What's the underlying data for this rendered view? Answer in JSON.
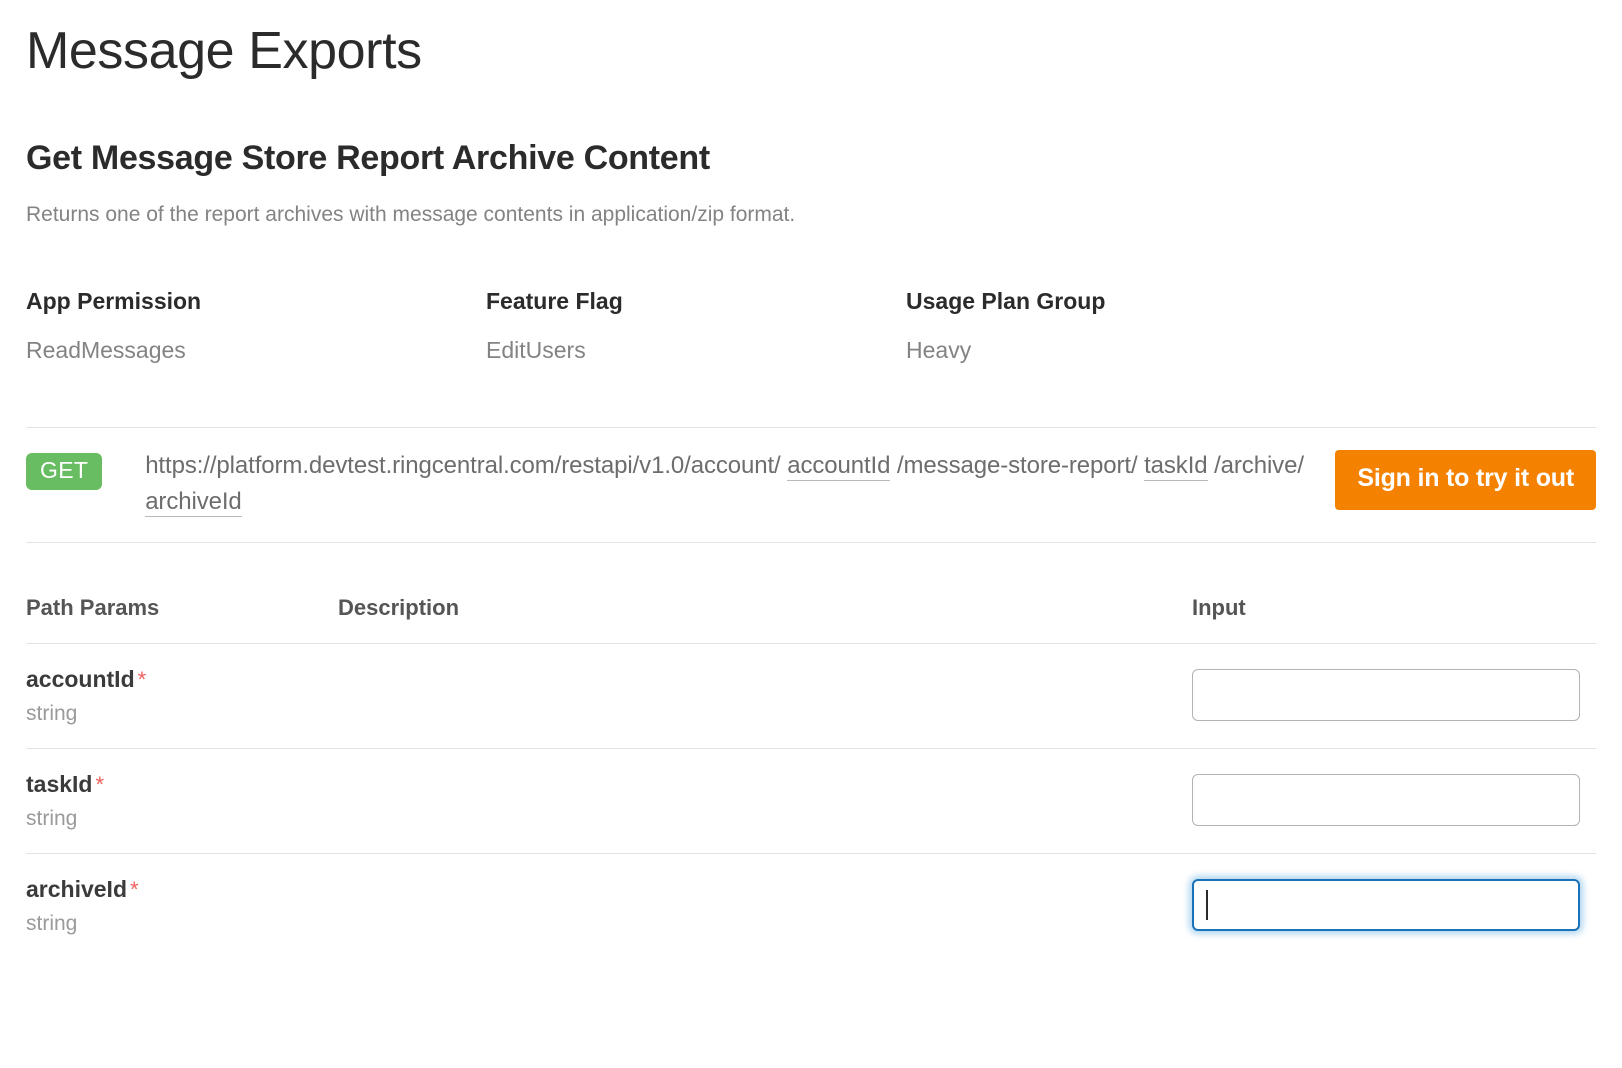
{
  "page": {
    "title": "Message Exports",
    "section_title": "Get Message Store Report Archive Content",
    "description": "Returns one of the report archives with message contents in application/zip format."
  },
  "meta": {
    "columns": [
      {
        "label": "App Permission",
        "value": "ReadMessages"
      },
      {
        "label": "Feature Flag",
        "value": "EditUsers"
      },
      {
        "label": "Usage Plan Group",
        "value": "Heavy"
      }
    ]
  },
  "endpoint": {
    "method": "GET",
    "url_parts": [
      {
        "text": "https://platform.devtest.ringcentral.com/restapi/v1.0/account/ ",
        "param": false
      },
      {
        "text": "accountId",
        "param": true
      },
      {
        "text": " /message-store-report/ ",
        "param": false
      },
      {
        "text": "taskId",
        "param": true
      },
      {
        "text": " /archive/ ",
        "param": false
      },
      {
        "text": "archiveId",
        "param": true
      }
    ],
    "signin_label": "Sign in to try it out",
    "method_color": "#68bd62",
    "signin_color": "#f58100"
  },
  "params_table": {
    "headers": {
      "name": "Path Params",
      "description": "Description",
      "input": "Input"
    },
    "required_marker": "*",
    "rows": [
      {
        "name": "accountId",
        "required": true,
        "type": "string",
        "description": "",
        "value": "",
        "placeholder": "",
        "focused": false
      },
      {
        "name": "taskId",
        "required": true,
        "type": "string",
        "description": "",
        "value": "",
        "placeholder": "",
        "focused": false
      },
      {
        "name": "archiveId",
        "required": true,
        "type": "string",
        "description": "",
        "value": "",
        "placeholder": "",
        "focused": true
      }
    ]
  }
}
